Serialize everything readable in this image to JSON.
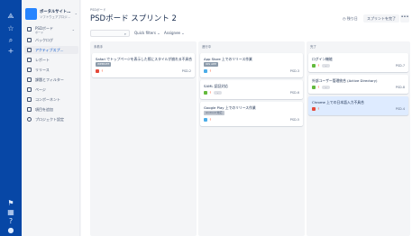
{
  "rail": {
    "items": [
      {
        "icon": "atlassian-logo-icon",
        "glyph": "⟁"
      },
      {
        "icon": "star-icon",
        "glyph": "☆"
      },
      {
        "icon": "search-icon",
        "glyph": "⌕"
      },
      {
        "icon": "create-icon",
        "glyph": "+"
      },
      {
        "icon": "notifications-icon",
        "glyph": "⚑"
      },
      {
        "icon": "apps-icon",
        "glyph": "▦"
      },
      {
        "icon": "help-icon",
        "glyph": "?"
      },
      {
        "icon": "profile-icon",
        "glyph": "●"
      }
    ]
  },
  "project": {
    "name": "ボータルサイト…",
    "type": "ソフトウェアプロジ…"
  },
  "sidebar": {
    "items": [
      {
        "label": "PSDボード",
        "sub": "ボード",
        "icon": "board-icon",
        "chevron": "⌄"
      },
      {
        "label": "バックログ",
        "icon": "backlog-icon"
      },
      {
        "label": "アクティブスプ…",
        "icon": "active-sprint-icon"
      },
      {
        "label": "レポート",
        "icon": "reports-icon"
      },
      {
        "label": "リリース",
        "icon": "releases-icon"
      },
      {
        "label": "課題とフィルター",
        "icon": "issues-filters-icon"
      },
      {
        "label": "ページ",
        "icon": "pages-icon"
      },
      {
        "label": "コンポーネント",
        "icon": "components-icon"
      },
      {
        "label": "項目を追加",
        "icon": "add-item-icon"
      },
      {
        "label": "プロジェクト設定",
        "icon": "settings-icon"
      }
    ]
  },
  "header": {
    "breadcrumb": "PSDボード",
    "title": "PSDボード スプリント 2",
    "time_remaining": "◷ 残り日",
    "complete_label": "スプリントを完了",
    "more_label": "•••"
  },
  "toolbar": {
    "search_icon": "⌕",
    "quick_filters": "Quick filters ⌄",
    "assignee": "Assignee ⌄"
  },
  "columns": [
    {
      "name": "未着手",
      "cards": [
        {
          "title": "Safari でトップページを表示した際にスタイルが崩れる不具合",
          "label": "WEBSITE",
          "label_style": "blue",
          "type": "bug",
          "priority": "↑",
          "key": "PSD-2"
        }
      ]
    },
    {
      "name": "進行中",
      "cards": [
        {
          "title": "App Store 上でのリリース作業",
          "label": "IOS APP",
          "label_style": "blue",
          "type": "task",
          "priority": "↑",
          "key": "PSD-3"
        },
        {
          "title": "SAML 認証対応",
          "type": "story",
          "priority": "↑",
          "estimate": "-",
          "key": "PSD-6"
        },
        {
          "title": "Google Play 上でのリリース作業",
          "label": "Android 対応",
          "label_style": "grey",
          "type": "task",
          "priority": "↑",
          "key": "PSD-5"
        }
      ]
    },
    {
      "name": "完了",
      "cards": [
        {
          "title": "ログイン機能",
          "type": "story",
          "priority": "↑",
          "estimate": "-",
          "key": "PSD-7"
        },
        {
          "title": "外部ユーザー管理統合 (Active Directory)",
          "type": "story",
          "priority": "↑",
          "estimate": "-",
          "key": "PSD-8"
        },
        {
          "title": "Chrome 上での日本語入力不具合",
          "type": "bug",
          "priority": "↑",
          "key": "PSD-4",
          "highlighted": true
        }
      ]
    }
  ],
  "colors": {
    "rail": "#0747a6",
    "accent": "#0052cc",
    "bug": "#e5493a",
    "story": "#63ba3c",
    "task": "#4bade8"
  }
}
